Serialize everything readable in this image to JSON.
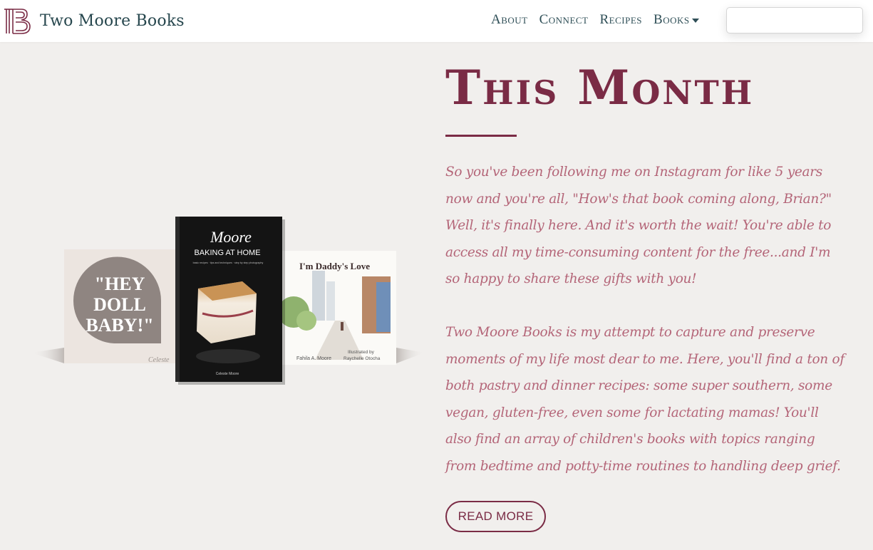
{
  "brand": {
    "name": "Two Moore Books",
    "logo_letters": "TMB",
    "logo_icon": "tmb-monogram-icon"
  },
  "nav": {
    "items": [
      {
        "label": "About"
      },
      {
        "label": "Connect"
      },
      {
        "label": "Recipes"
      },
      {
        "label": "Books",
        "dropdown": true,
        "icon": "caret-down-icon"
      }
    ]
  },
  "search": {
    "value": "",
    "placeholder": ""
  },
  "books_art": {
    "book1": {
      "title": "\"HEY DOLL BABY!\"",
      "line1": "\"HEY",
      "line2": "DOLL",
      "line3": "BABY!\"",
      "signature": "Celeste"
    },
    "book2": {
      "title_script": "Moore",
      "subtitle": "BAKING AT HOME",
      "tagline": "basic recipes · tips and techniques · step by step photography",
      "author": "Celeste Moore"
    },
    "book3": {
      "title": "I'm Daddy's Love",
      "author": "Fahila A. Moore",
      "illustrated_label": "Illustrated by",
      "illustrator": "Raychelle Otocha"
    }
  },
  "main": {
    "heading": "This Month",
    "paragraph1": "So you've been following me on Instagram for like 5 years now and you're all, \"How's that book coming along, Brian?\" Well, it's finally here. And it's worth the wait! You're able to access all my time-consuming content for the free...and I'm so happy to share these gifts with you!",
    "paragraph2": "Two Moore Books is my attempt to capture and preserve moments of my life most dear to me. Here, you'll find a ton of both pastry and dinner recipes: some super southern, some vegan, gluten-free, even some for lactating mamas! You'll also find an array of children's books with topics ranging from bedtime and potty-time routines to handling deep grief.",
    "cta_label": "READ MORE"
  },
  "colors": {
    "accent": "#7a2b45",
    "text_pink": "#b46578",
    "nav_text": "#2f4f57",
    "background": "#f1efed"
  }
}
